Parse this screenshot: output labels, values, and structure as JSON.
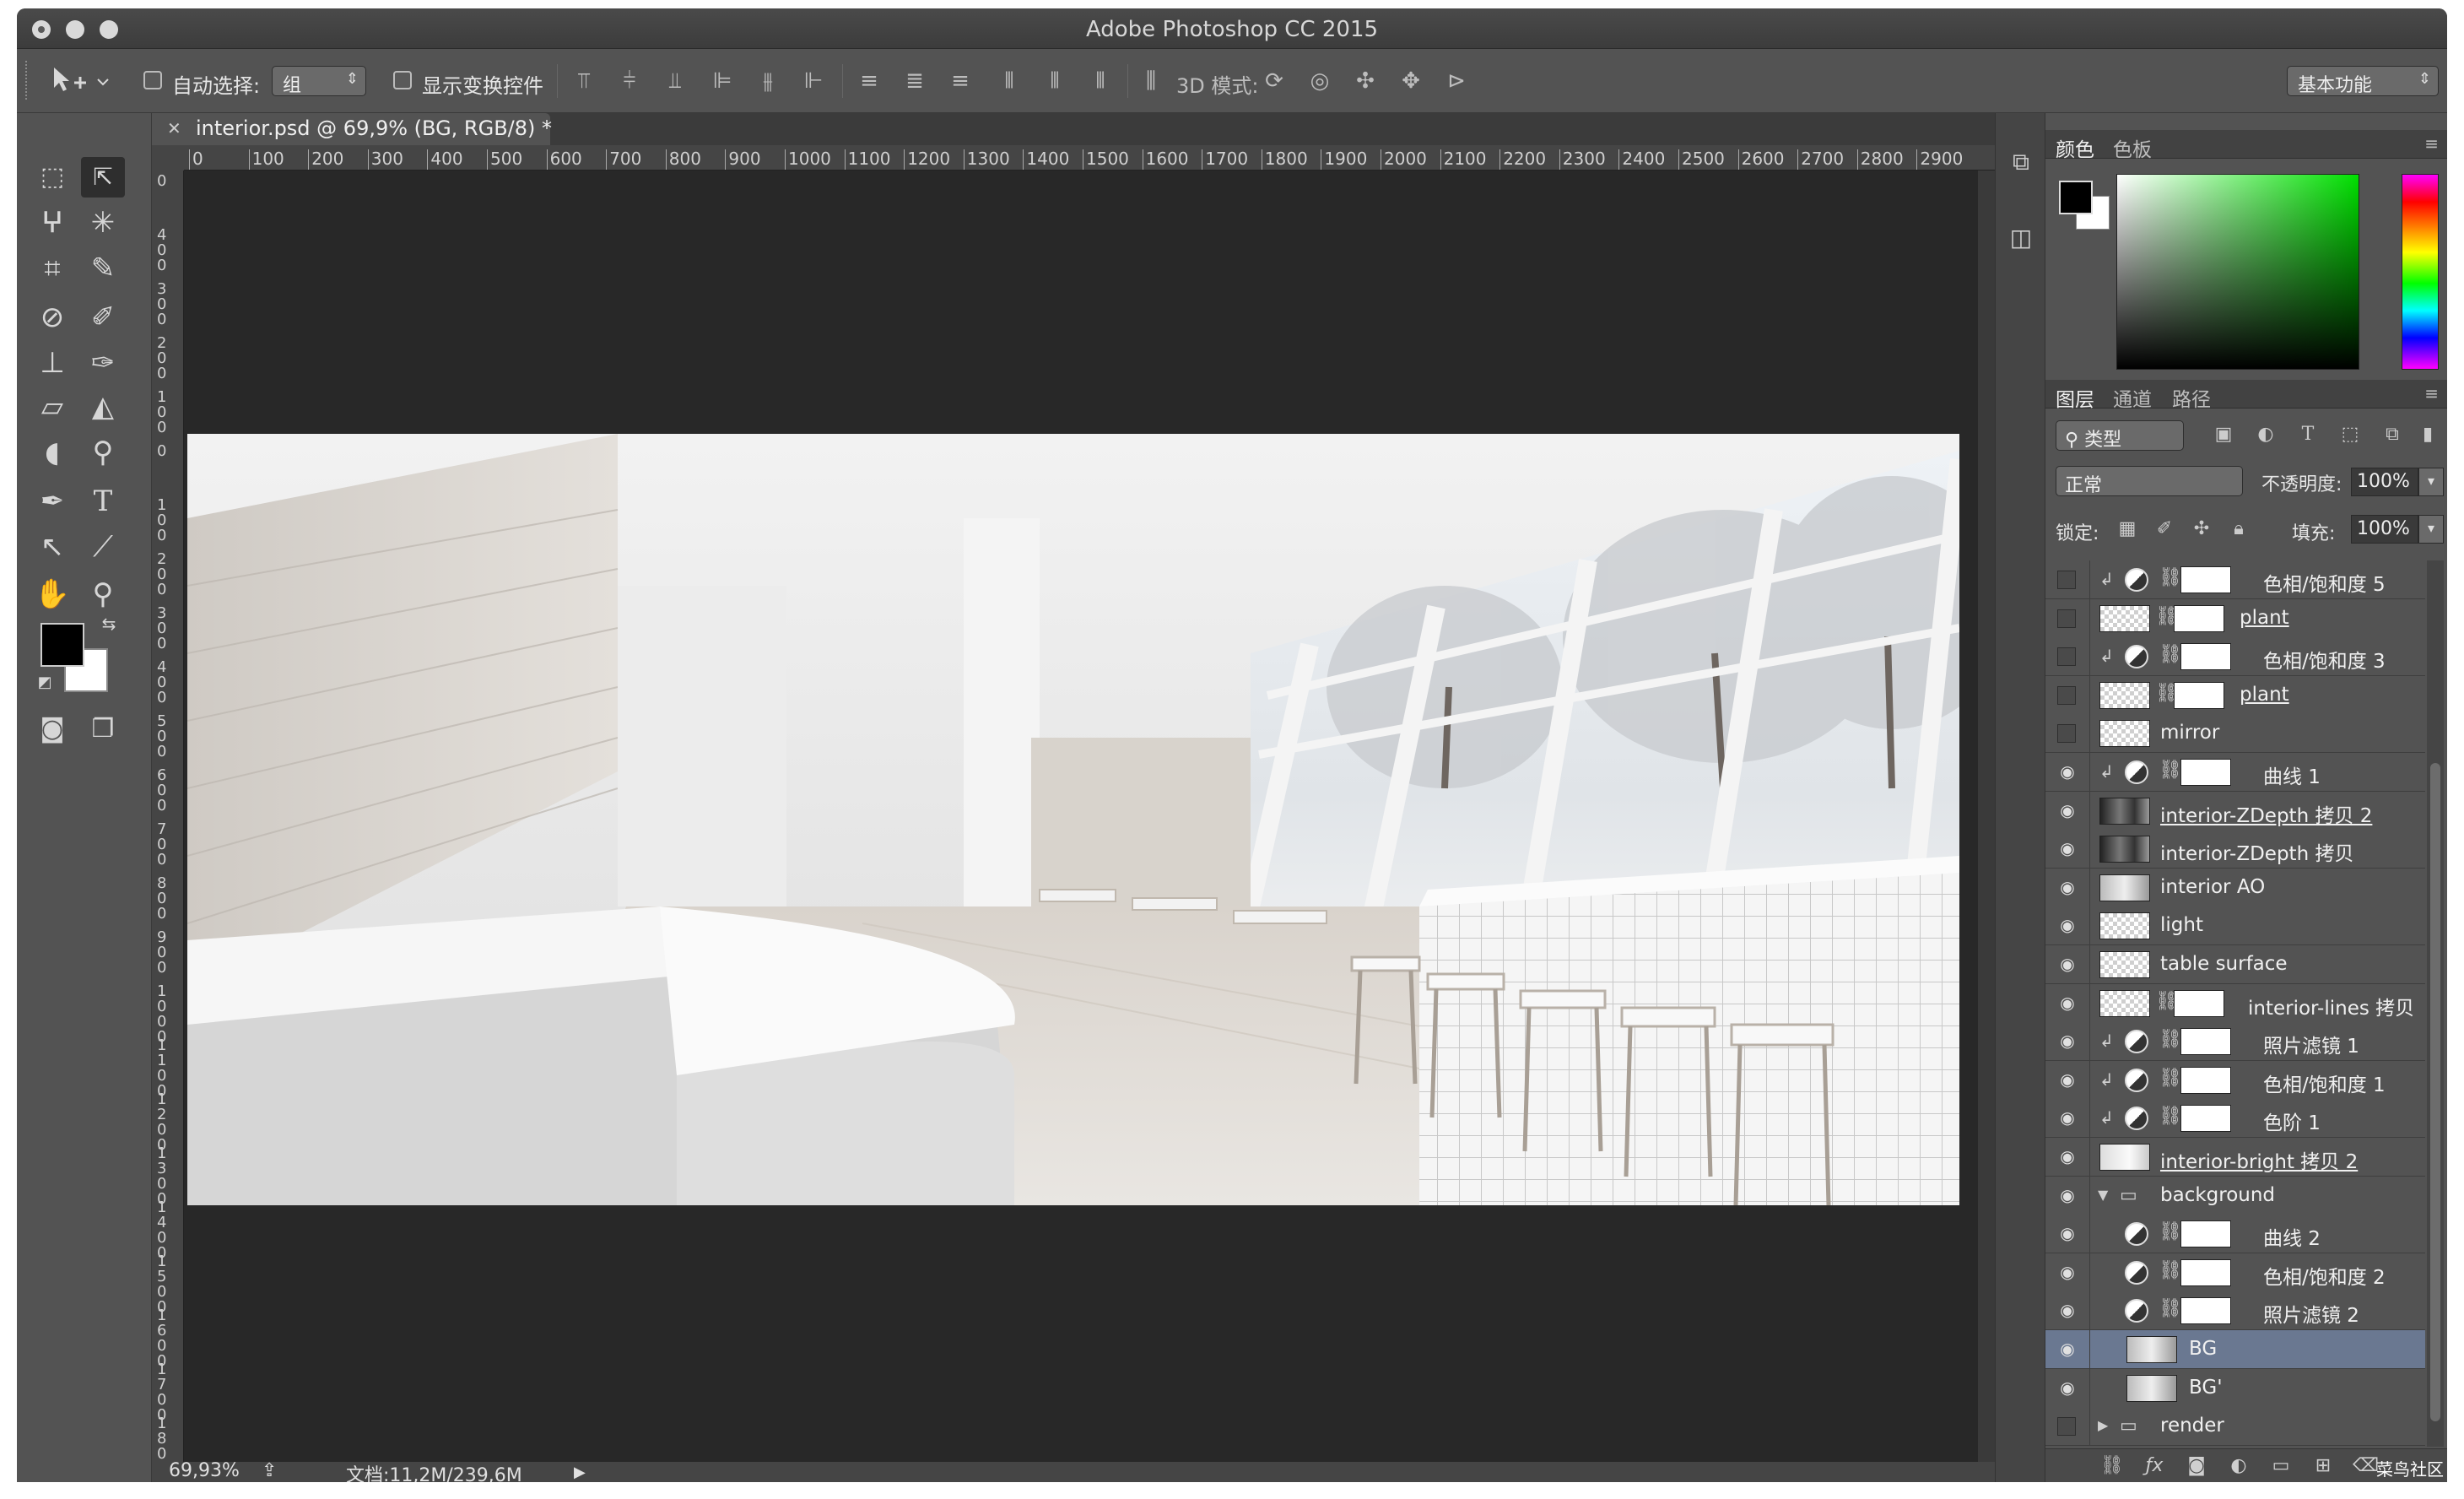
{
  "window": {
    "title": "Adobe Photoshop CC 2015"
  },
  "options_bar": {
    "auto_select_label": "自动选择:",
    "auto_select_value": "组",
    "show_transform_label": "显示变换控件",
    "mode_3d_label": "3D 模式:",
    "workspace": "基本功能"
  },
  "document": {
    "tab_title": "interior.psd @ 69,9% (BG, RGB/8) *",
    "ruler_h": [
      "0",
      "100",
      "200",
      "300",
      "400",
      "500",
      "600",
      "700",
      "800",
      "900",
      "1000",
      "1100",
      "1200",
      "1300",
      "1400",
      "1500",
      "1600",
      "1700",
      "1800",
      "1900",
      "2000",
      "2100",
      "2200",
      "2300",
      "2400",
      "2500",
      "2600",
      "2700",
      "2800",
      "2900"
    ],
    "ruler_v": [
      "0",
      "400",
      "300",
      "200",
      "100",
      "0",
      "100",
      "200",
      "300",
      "400",
      "500",
      "600",
      "700",
      "800",
      "900",
      "1000",
      "1100",
      "1200",
      "1300",
      "1400",
      "1500",
      "1600",
      "1700",
      "1800"
    ],
    "zoom": "69,93%",
    "doc_size": "文档:11,2M/239,6M"
  },
  "color_panel": {
    "tabs": [
      "颜色",
      "色板"
    ],
    "hue_hex": "#00e000"
  },
  "layers_panel": {
    "tabs": [
      "图层",
      "通道",
      "路径"
    ],
    "filter_label": "类型",
    "blend_mode": "正常",
    "opacity_label": "不透明度:",
    "opacity_value": "100%",
    "lock_label": "锁定:",
    "fill_label": "填充:",
    "fill_value": "100%",
    "selected_color": "#6a7891",
    "layers": [
      {
        "name": "色相/饱和度 5",
        "visible": false,
        "kind": "adjustment",
        "clipped": true,
        "linked": false
      },
      {
        "name": "plant",
        "visible": false,
        "kind": "masked",
        "clipped": false,
        "linked": true
      },
      {
        "name": "色相/饱和度 3",
        "visible": false,
        "kind": "adjustment",
        "clipped": true,
        "linked": false
      },
      {
        "name": "plant",
        "visible": false,
        "kind": "masked",
        "clipped": false,
        "linked": true
      },
      {
        "name": "mirror",
        "visible": false,
        "kind": "pixel",
        "clipped": false,
        "linked": false
      },
      {
        "name": "曲线 1",
        "visible": true,
        "kind": "adjustment",
        "clipped": true,
        "linked": false
      },
      {
        "name": "interior-ZDepth 拷贝 2",
        "visible": true,
        "kind": "image-dark",
        "clipped": false,
        "linked": true
      },
      {
        "name": "interior-ZDepth 拷贝",
        "visible": true,
        "kind": "image-dark",
        "clipped": false,
        "linked": false
      },
      {
        "name": "interior AO",
        "visible": true,
        "kind": "image-light",
        "clipped": false,
        "linked": false
      },
      {
        "name": "light",
        "visible": true,
        "kind": "pixel",
        "clipped": false,
        "linked": false
      },
      {
        "name": "table surface",
        "visible": true,
        "kind": "pixel",
        "clipped": false,
        "linked": false
      },
      {
        "name": "interior-lines 拷贝",
        "visible": true,
        "kind": "masked",
        "clipped": false,
        "linked": false
      },
      {
        "name": "照片滤镜 1",
        "visible": true,
        "kind": "adjustment",
        "clipped": true,
        "linked": false
      },
      {
        "name": "色相/饱和度 1",
        "visible": true,
        "kind": "adjustment",
        "clipped": true,
        "linked": false
      },
      {
        "name": "色阶 1",
        "visible": true,
        "kind": "adjustment",
        "clipped": true,
        "linked": false
      },
      {
        "name": "interior-bright 拷贝 2",
        "visible": true,
        "kind": "image-bright",
        "clipped": false,
        "linked": true
      },
      {
        "name": "background",
        "visible": true,
        "kind": "group-open",
        "clipped": false,
        "linked": false
      },
      {
        "name": "曲线 2",
        "visible": true,
        "kind": "adjustment-child",
        "clipped": false,
        "linked": false
      },
      {
        "name": "色相/饱和度 2",
        "visible": true,
        "kind": "adjustment-child",
        "clipped": false,
        "linked": false
      },
      {
        "name": "照片滤镜 2",
        "visible": true,
        "kind": "adjustment-child",
        "clipped": false,
        "linked": false
      },
      {
        "name": "BG",
        "visible": true,
        "kind": "image-child",
        "clipped": false,
        "linked": false,
        "selected": true
      },
      {
        "name": "BG'",
        "visible": true,
        "kind": "image-child",
        "clipped": false,
        "linked": false
      },
      {
        "name": "render",
        "visible": false,
        "kind": "group-closed",
        "clipped": false,
        "linked": false
      }
    ],
    "watermark": "菜鸟社区"
  }
}
